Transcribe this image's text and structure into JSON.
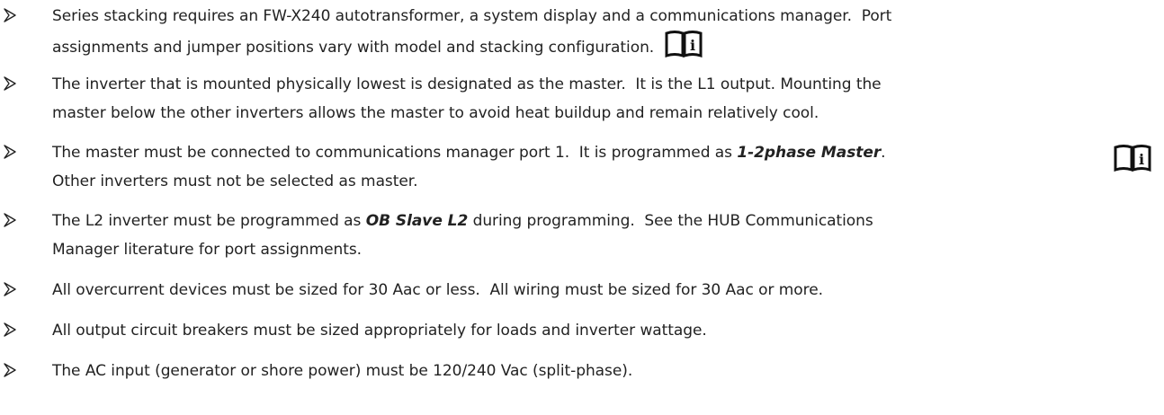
{
  "bullets": [
    {
      "lines": [
        "Series stacking requires an FW-X240 autotransformer, a system display and a communications manager.  Port",
        "assignments and jumper positions vary with model and stacking configuration. "
      ],
      "icon": "book-info-icon"
    },
    {
      "lines": [
        "The inverter that is mounted physically lowest is designated as the master.  It is the L1 output. Mounting the",
        "master below the other inverters allows the master to avoid heat buildup and remain relatively cool."
      ]
    },
    {
      "line1_pre": "The master must be connected to communications manager port 1.  It is programmed as ",
      "line1_emph": "1-2phase Master",
      "line1_post": ".",
      "line2": "Other inverters must not be selected as master.",
      "icon": "book-info-icon"
    },
    {
      "line1_pre": "The L2 inverter must be programmed as ",
      "line1_emph": "OB Slave L2",
      "line1_post": " during programming.  See the HUB Communications",
      "line2": "Manager literature for port assignments."
    },
    {
      "lines": [
        "All overcurrent devices must be sized for 30 Aac or less.  All wiring must be sized for 30 Aac or more."
      ]
    },
    {
      "lines": [
        "All output circuit breakers must be sized appropriately for loads and inverter wattage."
      ]
    },
    {
      "lines": [
        "The AC input (generator or shore power) must be 120/240 Vac (split-phase)."
      ]
    }
  ],
  "icon_glyph": "i"
}
